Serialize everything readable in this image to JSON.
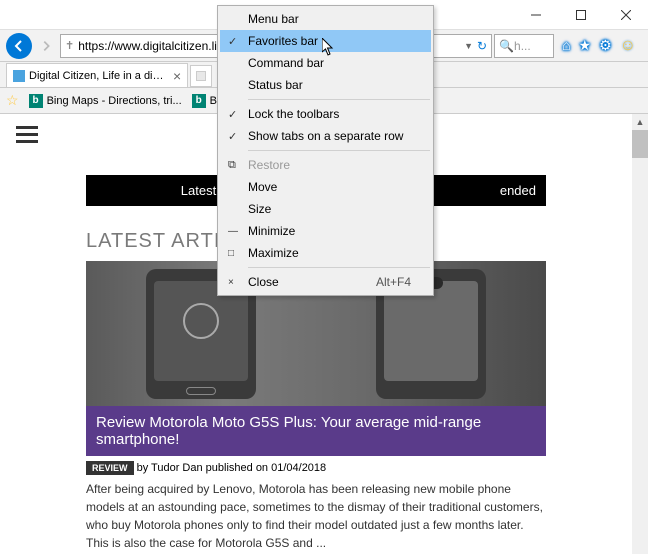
{
  "address": {
    "url": "https://www.digitalcitizen.life/",
    "search_placeholder": "h..."
  },
  "tabs": [
    {
      "title": "Digital Citizen, Life in a digi..."
    }
  ],
  "favorites": [
    {
      "label": "Bing Maps - Directions, tri..."
    },
    {
      "label": "Bing"
    }
  ],
  "page": {
    "nav_latest": "Latest",
    "nav_recommended": "ended",
    "section_title": "LATEST ARTIC",
    "article": {
      "title": "Review Motorola Moto G5S Plus: Your average mid-range smartphone!",
      "badge": "REVIEW",
      "meta": " by Tudor Dan published on 01/04/2018",
      "body": "After being acquired by Lenovo, Motorola has been releasing new mobile phone models at an astounding pace, sometimes to the dismay of their traditional customers, who buy Motorola phones only to find their model outdated just a few months later. This is also the case for Motorola G5S and ..."
    }
  },
  "contextmenu": {
    "items": [
      {
        "label": "Menu bar",
        "checked": false
      },
      {
        "label": "Favorites bar",
        "checked": true,
        "highlight": true
      },
      {
        "label": "Command bar",
        "checked": false
      },
      {
        "label": "Status bar",
        "checked": false
      }
    ],
    "items2": [
      {
        "label": "Lock the toolbars",
        "checked": true
      },
      {
        "label": "Show tabs on a separate row",
        "checked": true
      }
    ],
    "items3": [
      {
        "label": "Restore",
        "disabled": true,
        "mark": ""
      },
      {
        "label": "Move",
        "mark": ""
      },
      {
        "label": "Size",
        "mark": ""
      },
      {
        "label": "Minimize",
        "mark": "—"
      },
      {
        "label": "Maximize",
        "mark": "□"
      }
    ],
    "close": {
      "label": "Close",
      "shortcut": "Alt+F4",
      "mark": "×"
    }
  }
}
